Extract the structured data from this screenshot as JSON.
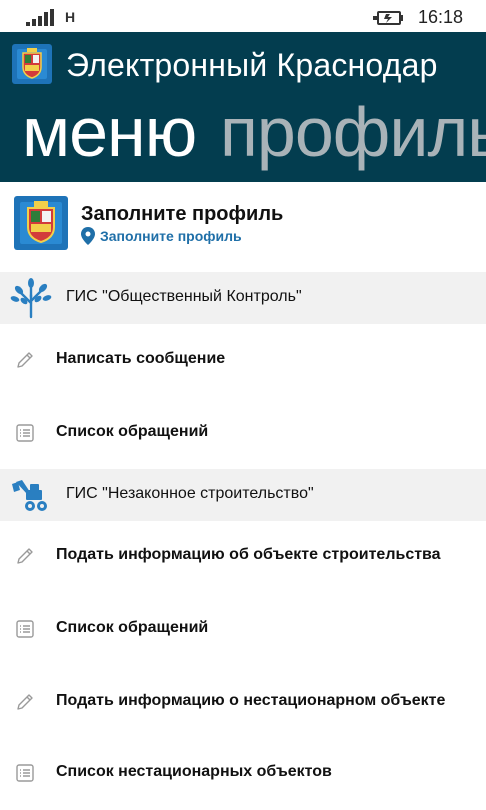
{
  "status_bar": {
    "network": "H",
    "time": "16:18"
  },
  "header": {
    "app_title": "Электронный Краснодар",
    "pivot_active": "меню",
    "pivot_next": "профиль"
  },
  "profile": {
    "name": "Заполните профиль",
    "link": "Заполните профиль"
  },
  "sections": [
    {
      "title": "ГИС \"Общественный Контроль\"",
      "icon": "tree-icon",
      "items": [
        {
          "label": "Написать сообщение",
          "icon": "pencil-icon"
        },
        {
          "label": "Список обращений",
          "icon": "list-icon"
        }
      ]
    },
    {
      "title": "ГИС \"Незаконное строительство\"",
      "icon": "excavator-icon",
      "items": [
        {
          "label": "Подать информацию об объекте строительства",
          "icon": "pencil-icon"
        },
        {
          "label": "Список обращений",
          "icon": "list-icon"
        },
        {
          "label": "Подать информацию о нестационарном объекте",
          "icon": "pencil-icon"
        },
        {
          "label": "Список нестационарных объектов",
          "icon": "list-icon"
        }
      ]
    }
  ],
  "colors": {
    "header_bg": "#033d4f",
    "pivot_inactive": "#a9b3b8",
    "link": "#1f6fa8",
    "section_bg": "#f1f1f1",
    "icon_blue": "#2a7fc1"
  }
}
